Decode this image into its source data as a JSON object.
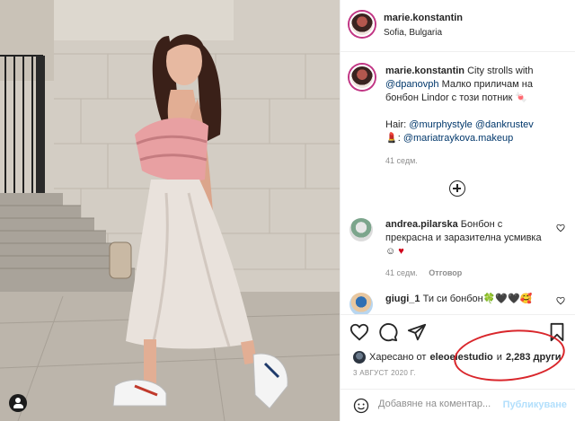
{
  "post": {
    "username": "marie.konstantin",
    "location": "Sofia, Bulgaria"
  },
  "caption": {
    "username": "marie.konstantin",
    "text_1": "City strolls with",
    "mention_1": "@dpanovph",
    "text_2": "Малко приличам на бонбон Lindor с този потник",
    "hair_label": "Hair:",
    "mention_2": "@murphystyle",
    "mention_3": "@dankrustev",
    "mention_4": "@mariatraykova.makeup",
    "time": "41 седм."
  },
  "comments": [
    {
      "username": "andrea.pilarska",
      "text": "Бонбон с прекрасна и заразителна усмивка ☺",
      "time": "41 седм.",
      "reply_label": "Отговор"
    },
    {
      "username": "giugi_1",
      "text": "Ти си бонбон🍀🖤🖤🥰"
    }
  ],
  "likes": {
    "prefix": "Харесано от",
    "liker": "eleoelestudio",
    "joiner": "и",
    "others": "2,283 други"
  },
  "date": "3 АВГУСТ 2020 Г.",
  "comment_box": {
    "placeholder": "Добавяне на коментар...",
    "post_label": "Публикуване"
  },
  "icons": {
    "like": "heart-icon",
    "comment": "comment-icon",
    "share": "share-icon",
    "save": "bookmark-icon",
    "emoji": "emoji-icon",
    "add": "plus-circle-icon",
    "profile": "user-icon"
  },
  "colors": {
    "link": "#00376b",
    "muted": "#8e8e8e",
    "highlight_ring": "#d9262b",
    "post_button": "#b2dffc"
  }
}
